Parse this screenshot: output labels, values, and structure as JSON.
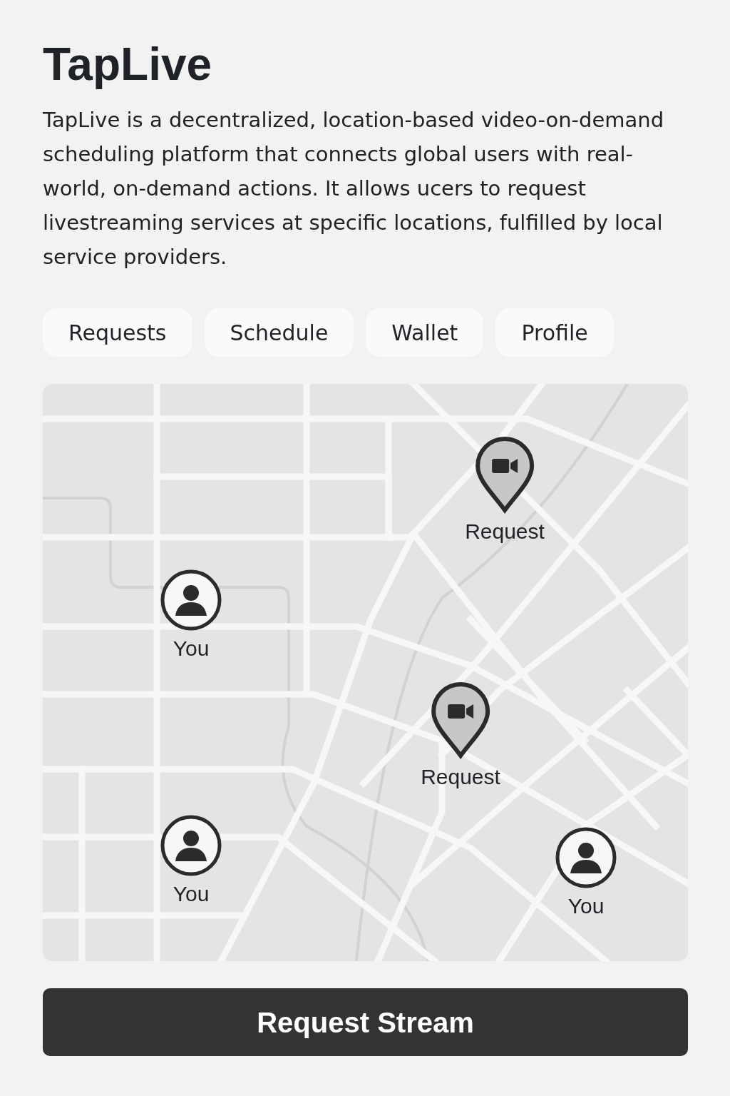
{
  "title": "TapLive",
  "description": "TapLive is a decentralized, location-based video-on-demand scheduling platform that connects global users with real-world, on-demand actions. It allows ucers to request livestreaming services at specific locations, fulfilled by local service providers.",
  "tabs": [
    "Requests",
    "Schedule",
    "Wallet",
    "Profile"
  ],
  "map": {
    "markers": [
      {
        "kind": "request",
        "label": "Request"
      },
      {
        "kind": "you",
        "label": "You"
      },
      {
        "kind": "request",
        "label": "Request"
      },
      {
        "kind": "you",
        "label": "You"
      },
      {
        "kind": "you",
        "label": "You"
      }
    ]
  },
  "action_button": "Request Stream"
}
